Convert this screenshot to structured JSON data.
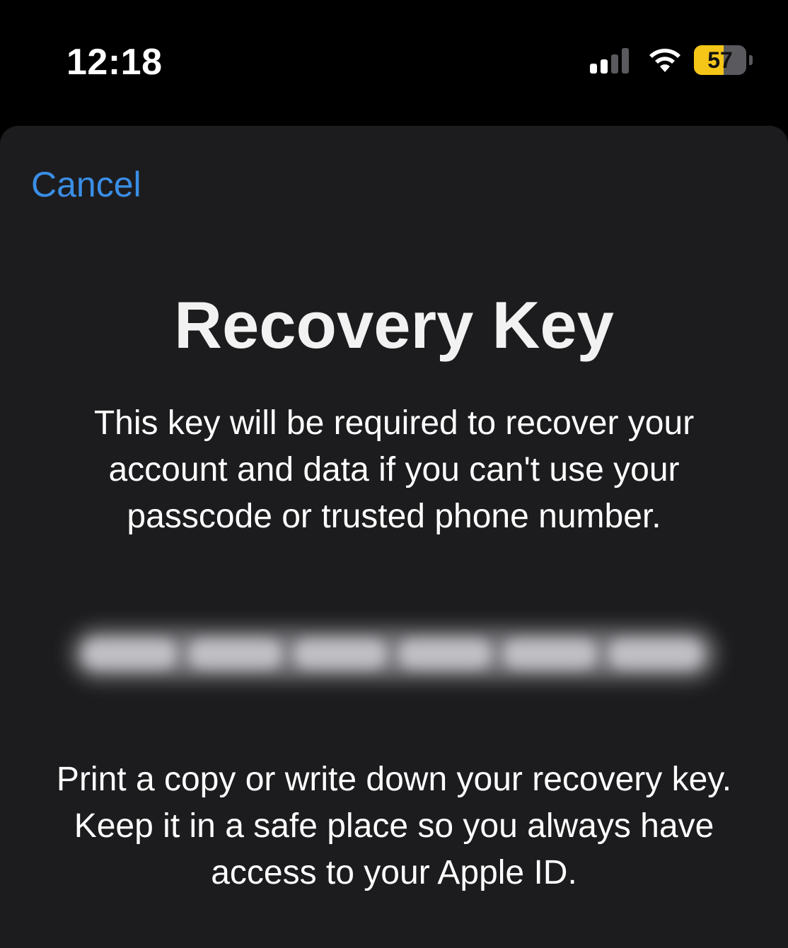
{
  "status_bar": {
    "time": "12:18",
    "battery_level": "57",
    "battery_fraction": 0.57,
    "signal_bars_active": 2,
    "signal_bars_total": 4,
    "battery_color": "#f5c518"
  },
  "sheet": {
    "cancel_label": "Cancel",
    "title": "Recovery Key",
    "description": "This key will be required to recover your account and data if you can't use your passcode or trusted phone number.",
    "print_instructions": "Print a copy or write down your recovery key. Keep it in a safe place so you always have access to your Apple ID.",
    "accent_color": "#3a8ee6"
  }
}
